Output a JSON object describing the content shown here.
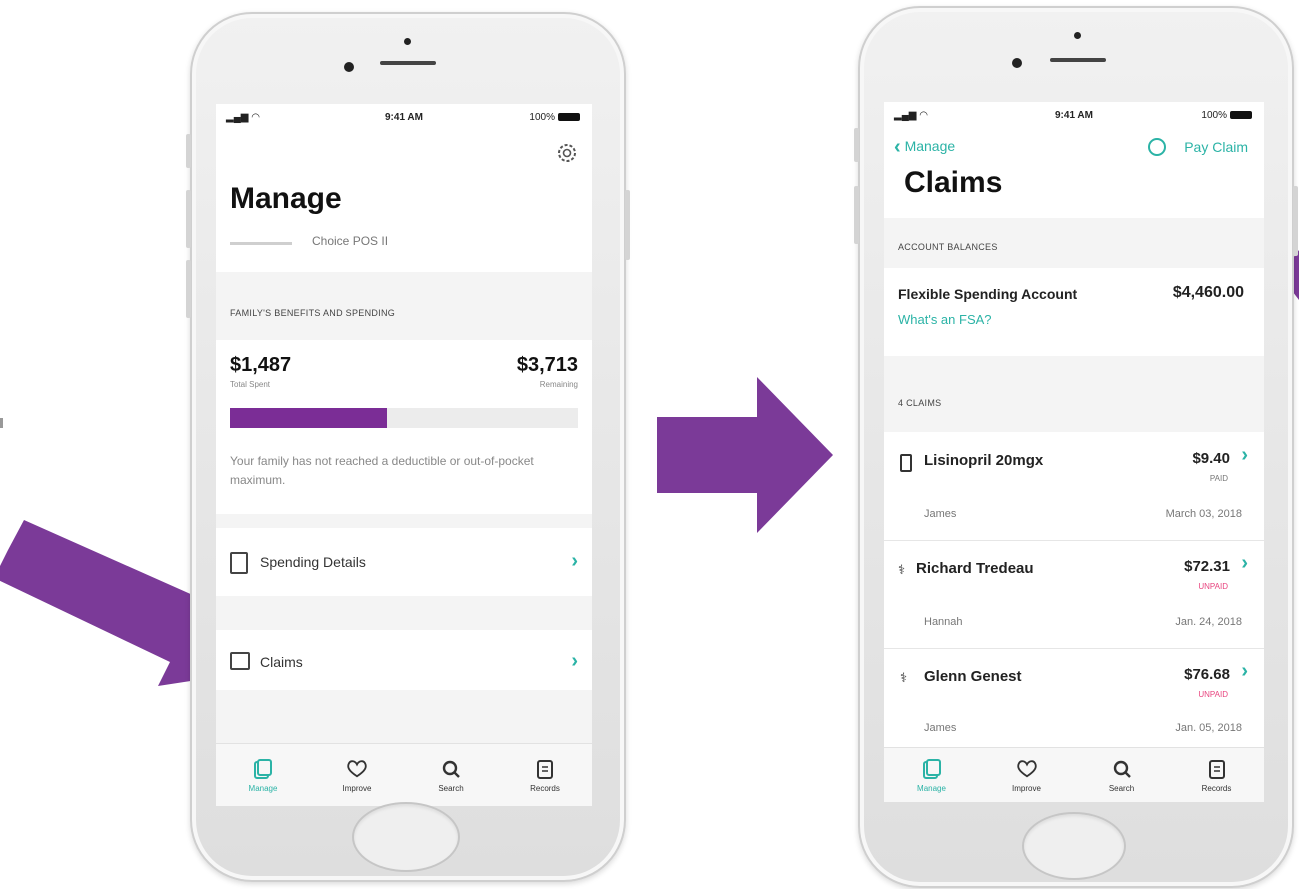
{
  "colors": {
    "accent_teal": "#2bb3a6",
    "arrow_purple": "#7b3a98",
    "progress_purple": "#7b2d96",
    "unpaid_pink": "#e8457f"
  },
  "left_phone": {
    "status": {
      "time": "9:41 AM",
      "battery": "100%"
    },
    "title": "Manage",
    "plan_name": "Choice POS II",
    "section_header": "FAMILY'S BENEFITS AND SPENDING",
    "spent_amount": "$1,487",
    "spent_label": "Total Spent",
    "remaining_amount": "$3,713",
    "remaining_label": "Remaining",
    "progress_fraction": 0.45,
    "note": "Your family has not reached a deductible or out-of-pocket maximum.",
    "menu": [
      {
        "label": "Spending Details",
        "icon": "document-icon"
      },
      {
        "label": "Claims",
        "icon": "claims-icon"
      }
    ],
    "tabs": [
      {
        "label": "Manage",
        "icon": "cards-icon",
        "active": true
      },
      {
        "label": "Improve",
        "icon": "heart-icon",
        "active": false
      },
      {
        "label": "Search",
        "icon": "search-icon",
        "active": false
      },
      {
        "label": "Records",
        "icon": "clipboard-icon",
        "active": false
      }
    ]
  },
  "right_phone": {
    "status": {
      "time": "9:41 AM",
      "battery": "100%"
    },
    "back_label": "Manage",
    "pay_claim_label": "Pay Claim",
    "title": "Claims",
    "balances_header": "ACCOUNT BALANCES",
    "account_name": "Flexible Spending Account",
    "account_amount": "$4,460.00",
    "fsa_link": "What's an FSA?",
    "claims_header": "4 CLAIMS",
    "claims": [
      {
        "name": "Lisinopril 20mgx",
        "amount": "$9.40",
        "status": "PAID",
        "person": "James",
        "date": "March 03, 2018",
        "icon": "pill-bottle-icon"
      },
      {
        "name": "Richard Tredeau",
        "amount": "$72.31",
        "status": "UNPAID",
        "person": "Hannah",
        "date": "Jan. 24, 2018",
        "icon": "stethoscope-icon"
      },
      {
        "name": "Glenn Genest",
        "amount": "$76.68",
        "status": "UNPAID",
        "person": "James",
        "date": "Jan. 05, 2018",
        "icon": "stethoscope-icon"
      }
    ],
    "tabs": [
      {
        "label": "Manage",
        "icon": "cards-icon",
        "active": true
      },
      {
        "label": "Improve",
        "icon": "heart-icon",
        "active": false
      },
      {
        "label": "Search",
        "icon": "search-icon",
        "active": false
      },
      {
        "label": "Records",
        "icon": "clipboard-icon",
        "active": false
      }
    ]
  }
}
